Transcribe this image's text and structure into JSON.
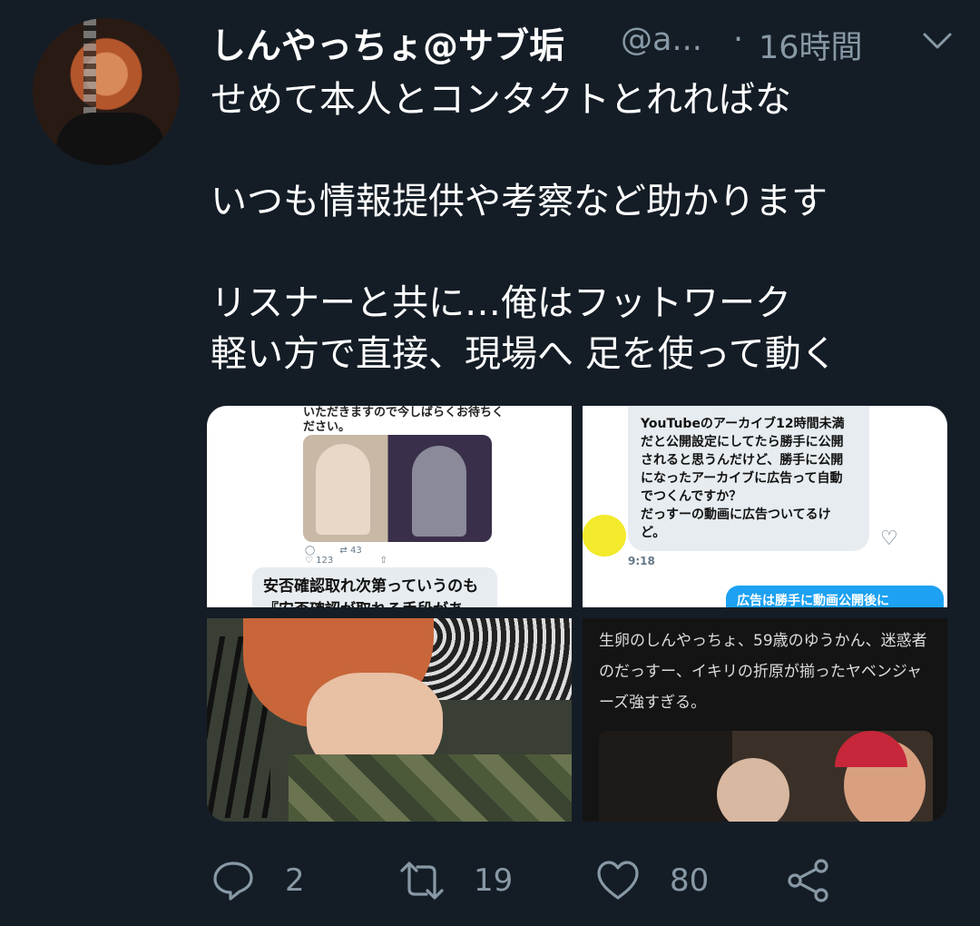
{
  "tweet": {
    "display_name": "しんやっちょ@サブ垢",
    "handle": "@a...",
    "separator": "·",
    "time": "16時間",
    "lines": [
      "せめて本人とコンタクトとれればな",
      "",
      "いつも情報提供や考察など助かります",
      "",
      "リスナーと共に…俺はフットワーク",
      "軽い方で直接、現場へ 足を使って動く"
    ]
  },
  "images": {
    "img1": {
      "top_text": "いただきますので今しばらくお待ちください。",
      "retweets": "43",
      "likes": "123",
      "bubble_text": "安否確認取れ次第っていうのも『安否確認が取れる手段がある』ってこ"
    },
    "img2": {
      "message": "YouTubeのアーカイブ12時間未満\nだと公開設定にしてたら勝手に公開\nされると思うんだけど、勝手に公開\nになったアーカイブに広告って自動\nでつくんですか？\nだっすーの動画に広告ついてるけ\nど。",
      "timestamp": "9:18",
      "reply_preview": "広告は勝手に動画公開後に"
    },
    "img4": {
      "caption": "生卵のしんやっちょ、59歳のゆうかん、迷惑者のだっすー、イキリの折原が揃ったヤベンジャーズ強すぎる。"
    }
  },
  "actions": {
    "replies": "2",
    "retweets": "19",
    "likes": "80"
  },
  "colors": {
    "background": "#141d26",
    "secondary_text": "#8899a6",
    "link_blue": "#1da1f2"
  }
}
